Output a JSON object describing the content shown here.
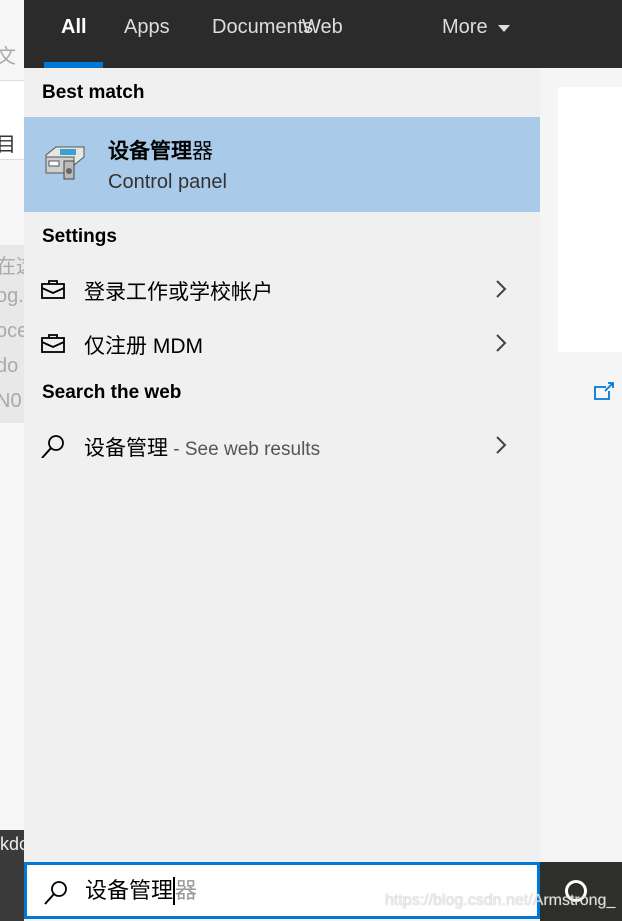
{
  "background_fragments": [
    "文",
    "目",
    "在这",
    "og.",
    "oce",
    "do",
    "N0",
    "kdc"
  ],
  "tabs": [
    {
      "label": "All",
      "active": true
    },
    {
      "label": "Apps"
    },
    {
      "label": "Documents"
    },
    {
      "label": "Web"
    },
    {
      "label": "More",
      "icon": "caret-down-icon"
    }
  ],
  "best_match": {
    "header": "Best match",
    "title_bold": "设备管理",
    "title_rest": "器",
    "subtitle": "Control panel",
    "icon": "device-manager-icon"
  },
  "settings": {
    "header": "Settings",
    "items": [
      {
        "label": "登录工作或学校帐户",
        "icon": "briefcase-icon"
      },
      {
        "label": "仅注册 MDM",
        "icon": "briefcase-icon"
      }
    ]
  },
  "web": {
    "header": "Search the web",
    "query": "设备管理",
    "suffix": " - See web results",
    "icon": "search-icon"
  },
  "search": {
    "typed": "设备管理",
    "suggestion": "器"
  },
  "watermark": "https://blog.csdn.net/Armstrong_",
  "colors": {
    "accent": "#0078d7",
    "selected": "#a9cbe9",
    "topbar": "#2b2b2b"
  }
}
